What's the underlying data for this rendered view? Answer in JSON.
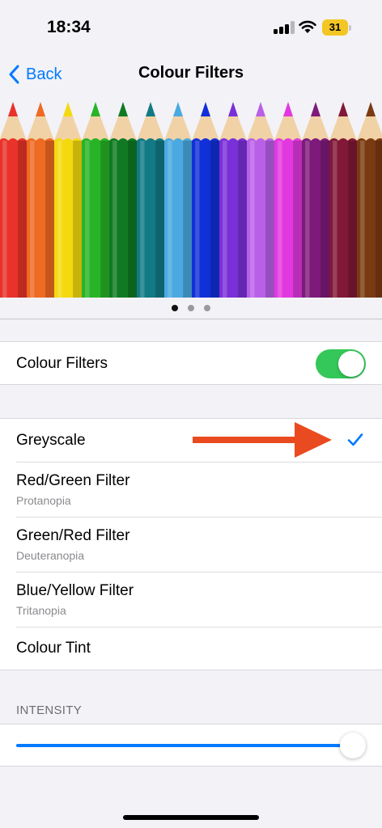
{
  "status_bar": {
    "time": "18:34",
    "battery": "31",
    "battery_color": "#f3c623"
  },
  "nav": {
    "back_label": "Back",
    "title": "Colour Filters"
  },
  "illustration": {
    "pencil_colors": [
      "#e8322a",
      "#ef6a22",
      "#f4d90f",
      "#28b427",
      "#0f7a23",
      "#127a84",
      "#4aa9e0",
      "#1230d8",
      "#7a30d8",
      "#b960e8",
      "#e238e0",
      "#7e1a7a",
      "#821838",
      "#7a3a12"
    ],
    "pages": 3,
    "active_page": 0
  },
  "colour_filters_toggle": {
    "label": "Colour Filters",
    "on": true,
    "on_color": "#34c759"
  },
  "filters": [
    {
      "title": "Greyscale",
      "subtitle": "",
      "selected": true
    },
    {
      "title": "Red/Green Filter",
      "subtitle": "Protanopia",
      "selected": false
    },
    {
      "title": "Green/Red Filter",
      "subtitle": "Deuteranopia",
      "selected": false
    },
    {
      "title": "Blue/Yellow Filter",
      "subtitle": "Tritanopia",
      "selected": false
    },
    {
      "title": "Colour Tint",
      "subtitle": "",
      "selected": false
    }
  ],
  "intensity": {
    "header": "INTENSITY",
    "value": 1.0
  },
  "colors": {
    "accent": "#007aff",
    "annotation_arrow": "#ea4a1f"
  }
}
